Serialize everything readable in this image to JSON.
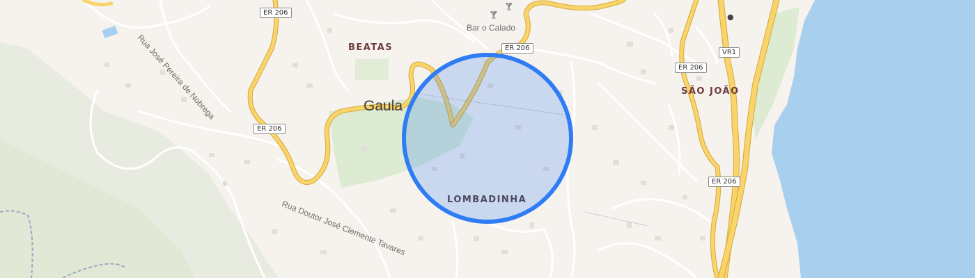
{
  "map": {
    "places": {
      "beatas": "BEATAS",
      "gaula": "Gaula",
      "sao_joao": "SÃO JOÃO",
      "lombadinha": "LOMBADINHA"
    },
    "pois": {
      "bar": "Bar o Calado"
    },
    "streets": {
      "rua_jose_pereira": "Rua José Pereira de Nobrega",
      "rua_doutor": "Rua Doutor José Clemente Tavares"
    },
    "road_shields": {
      "er206_top": "ER 206",
      "er206_mid": "ER 206",
      "er206_left": "ER 206",
      "er206_right1": "ER 206",
      "er206_right2": "ER 206",
      "vr1": "VR1"
    },
    "icons": {
      "bar_icon": "cocktail-glass",
      "cafe_icon": "cocktail-glass",
      "shop_icon": "basket"
    },
    "colors": {
      "background": "#f6f3ee",
      "water": "#a9cfef",
      "park": "#dcebd2",
      "forest": "#e5ebdc",
      "major_road": "#f9d46a",
      "road_casing": "#d4a93c",
      "minor_road": "#ffffff",
      "selection_stroke": "#2f7cf5",
      "selection_fill": "rgba(47,124,245,0.22)",
      "place_label": "#6e3b3b",
      "district_label": "#4a4a5e"
    }
  }
}
